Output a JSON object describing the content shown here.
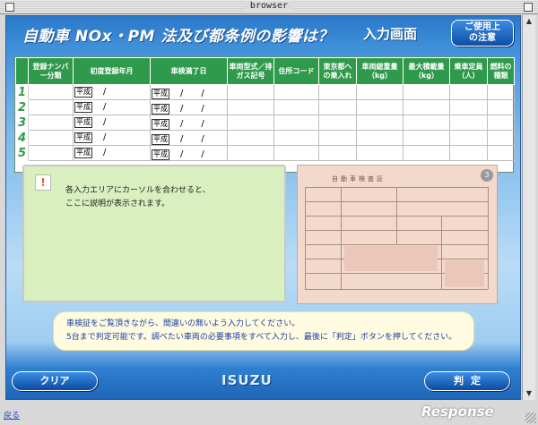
{
  "window": {
    "title": "browser"
  },
  "header": {
    "title": "自動車 NOx・PM 法及び都条例の影響は？",
    "screen_name": "入力画面",
    "notes_button": [
      "ご使用上",
      "の注意"
    ]
  },
  "table": {
    "columns": [
      "登録ナンバー分類",
      "初度登録年月",
      "車検満了日",
      "車両型式／排ガス記号",
      "住所コード",
      "東京都への乗入れ",
      "車両総重量（kg）",
      "最大積載量（kg）",
      "乗車定員（人）",
      "燃料の種類"
    ],
    "rows": [
      {
        "num": "1",
        "era1": "平成",
        "sep1": "/",
        "era2": "平成",
        "sep2": "/　　/"
      },
      {
        "num": "2",
        "era1": "平成",
        "sep1": "/",
        "era2": "平成",
        "sep2": "/　　/"
      },
      {
        "num": "3",
        "era1": "平成",
        "sep1": "/",
        "era2": "平成",
        "sep2": "/　　/"
      },
      {
        "num": "4",
        "era1": "平成",
        "sep1": "/",
        "era2": "平成",
        "sep2": "/　　/"
      },
      {
        "num": "5",
        "era1": "平成",
        "sep1": "/",
        "era2": "平成",
        "sep2": "/　　/"
      }
    ]
  },
  "info_panel": {
    "icon": "exclamation-icon",
    "lines": [
      "各入力エリアにカーソルを合わせると、",
      "ここに説明が表示されます。"
    ]
  },
  "document": {
    "title": "自動車検査証",
    "badge": "3"
  },
  "instruction": {
    "lines": [
      "車検証をご覧頂きながら、間違いの無いよう入力してください。",
      "5台まで判定可能です。調べたい車両の必要事項をすべて入力し、最後に「判定」ボタンを押してください。"
    ]
  },
  "footer": {
    "clear_label": "クリア",
    "brand": "ISUZU",
    "judge_label": "判定",
    "back_link": "戻る",
    "watermark": "Response"
  },
  "colors": {
    "header_green": "#2f9a4b",
    "button_blue": "#0c4aa0",
    "panel_green": "#d9efc0",
    "doc_pink": "#f3d9cc"
  }
}
